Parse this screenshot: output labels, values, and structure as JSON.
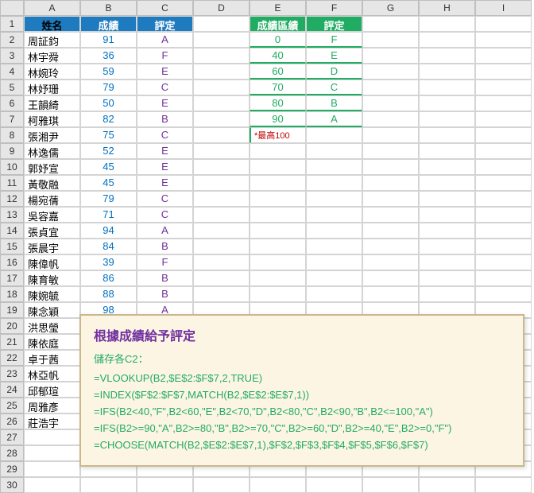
{
  "columns": [
    "A",
    "B",
    "C",
    "D",
    "E",
    "F",
    "G",
    "H",
    "I"
  ],
  "rows": [
    "1",
    "2",
    "3",
    "4",
    "5",
    "6",
    "7",
    "8",
    "9",
    "10",
    "11",
    "12",
    "13",
    "14",
    "15",
    "16",
    "17",
    "18",
    "19",
    "20",
    "21",
    "22",
    "23",
    "24",
    "25",
    "26",
    "27",
    "28",
    "29",
    "30"
  ],
  "main_header": {
    "name": "姓名",
    "score": "成績",
    "grade": "評定"
  },
  "lookup_header": {
    "range": "成績區績",
    "grade": "評定"
  },
  "students": [
    {
      "name": "周証鈞",
      "score": "91",
      "grade": "A"
    },
    {
      "name": "林宇舜",
      "score": "36",
      "grade": "F"
    },
    {
      "name": "林婉玲",
      "score": "59",
      "grade": "E"
    },
    {
      "name": "林妤珊",
      "score": "79",
      "grade": "C"
    },
    {
      "name": "王韻綺",
      "score": "50",
      "grade": "E"
    },
    {
      "name": "柯雅琪",
      "score": "82",
      "grade": "B"
    },
    {
      "name": "張湘尹",
      "score": "75",
      "grade": "C"
    },
    {
      "name": "林逸儒",
      "score": "52",
      "grade": "E"
    },
    {
      "name": "郭妤宣",
      "score": "45",
      "grade": "E"
    },
    {
      "name": "黃敬融",
      "score": "45",
      "grade": "E"
    },
    {
      "name": "楊宛蒨",
      "score": "79",
      "grade": "C"
    },
    {
      "name": "吳容嘉",
      "score": "71",
      "grade": "C"
    },
    {
      "name": "張貞宜",
      "score": "94",
      "grade": "A"
    },
    {
      "name": "張晨宇",
      "score": "84",
      "grade": "B"
    },
    {
      "name": "陳偉帆",
      "score": "39",
      "grade": "F"
    },
    {
      "name": "陳育敏",
      "score": "86",
      "grade": "B"
    },
    {
      "name": "陳婉毓",
      "score": "88",
      "grade": "B"
    },
    {
      "name": "陳念穎",
      "score": "98",
      "grade": "A"
    },
    {
      "name": "洪思瑩",
      "score": "",
      "grade": ""
    },
    {
      "name": "陳依庭",
      "score": "",
      "grade": ""
    },
    {
      "name": "卓于茜",
      "score": "",
      "grade": ""
    },
    {
      "name": "林亞帆",
      "score": "",
      "grade": ""
    },
    {
      "name": "邱郁瑄",
      "score": "",
      "grade": ""
    },
    {
      "name": "周雅彥",
      "score": "",
      "grade": ""
    },
    {
      "name": "莊浩宇",
      "score": "",
      "grade": ""
    }
  ],
  "lookup": [
    {
      "range": "0",
      "grade": "F"
    },
    {
      "range": "40",
      "grade": "E"
    },
    {
      "range": "60",
      "grade": "D"
    },
    {
      "range": "70",
      "grade": "C"
    },
    {
      "range": "80",
      "grade": "B"
    },
    {
      "range": "90",
      "grade": "A"
    }
  ],
  "note": "*最高100",
  "popup": {
    "title": "根據成績給予評定",
    "sub": "儲存各C2：",
    "formulas": [
      "=VLOOKUP(B2,$E$2:$F$7,2,TRUE)",
      "=INDEX($F$2:$F$7,MATCH(B2,$E$2:$E$7,1))",
      "=IFS(B2<40,\"F\",B2<60,\"E\",B2<70,\"D\",B2<80,\"C\",B2<90,\"B\",B2<=100,\"A\")",
      "=IFS(B2>=90,\"A\",B2>=80,\"B\",B2>=70,\"C\",B2>=60,\"D\",B2>=40,\"E\",B2>=0,\"F\")",
      "=CHOOSE(MATCH(B2,$E$2:$E$7,1),$F$2,$F$3,$F$4,$F$5,$F$6,$F$7)"
    ]
  },
  "chart_data": {
    "type": "table",
    "title": "根據成績給予評定",
    "primary_table": {
      "columns": [
        "姓名",
        "成績",
        "評定"
      ],
      "rows": [
        [
          "周証鈞",
          91,
          "A"
        ],
        [
          "林宇舜",
          36,
          "F"
        ],
        [
          "林婉玲",
          59,
          "E"
        ],
        [
          "林妤珊",
          79,
          "C"
        ],
        [
          "王韻綺",
          50,
          "E"
        ],
        [
          "柯雅琪",
          82,
          "B"
        ],
        [
          "張湘尹",
          75,
          "C"
        ],
        [
          "林逸儒",
          52,
          "E"
        ],
        [
          "郭妤宣",
          45,
          "E"
        ],
        [
          "黃敬融",
          45,
          "E"
        ],
        [
          "楊宛蒨",
          79,
          "C"
        ],
        [
          "吳容嘉",
          71,
          "C"
        ],
        [
          "張貞宜",
          94,
          "A"
        ],
        [
          "張晨宇",
          84,
          "B"
        ],
        [
          "陳偉帆",
          39,
          "F"
        ],
        [
          "陳育敏",
          86,
          "B"
        ],
        [
          "陳婉毓",
          88,
          "B"
        ],
        [
          "陳念穎",
          98,
          "A"
        ]
      ]
    },
    "lookup_table": {
      "columns": [
        "成績區績",
        "評定"
      ],
      "rows": [
        [
          0,
          "F"
        ],
        [
          40,
          "E"
        ],
        [
          60,
          "D"
        ],
        [
          70,
          "C"
        ],
        [
          80,
          "B"
        ],
        [
          90,
          "A"
        ]
      ],
      "note": "*最高100"
    }
  }
}
